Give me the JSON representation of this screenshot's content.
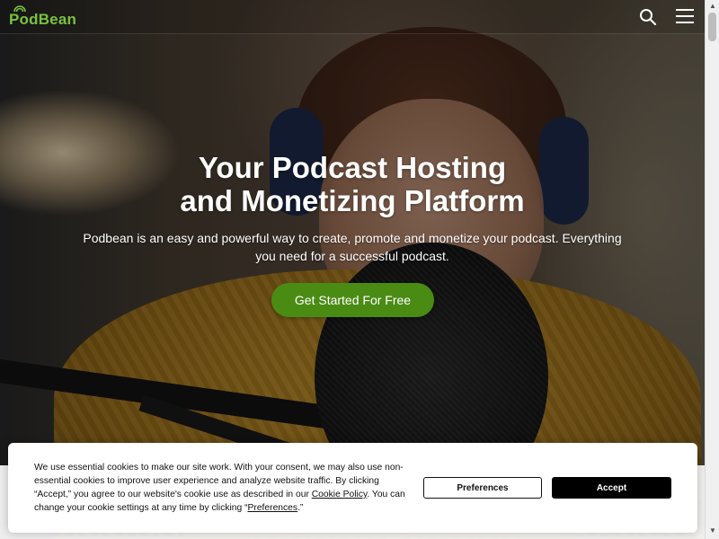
{
  "header": {
    "logo_text": "PodBean",
    "search_icon": "search-icon",
    "menu_icon": "hamburger-menu-icon"
  },
  "hero": {
    "title_line1": "Your Podcast Hosting",
    "title_line2": "and Monetizing Platform",
    "subtitle_line1": "Podbean is an easy and powerful way to create, promote and monetize your podcast. Everything",
    "subtitle_line2": "you need for a successful podcast.",
    "cta_label": "Get Started For Free"
  },
  "cookie_banner": {
    "text_part1": "We use essential cookies to make our site work. With your consent, we may also use non-essential cookies to improve user experience and analyze website traffic. By clicking “Accept,” you agree to our website's cookie use as described in our ",
    "cookie_policy_link": "Cookie Policy",
    "text_part2": ". You can change your cookie settings at any time by clicking “",
    "preferences_link": "Preferences",
    "text_part3": ".”",
    "preferences_button": "Preferences",
    "accept_button": "Accept"
  },
  "colors": {
    "brand_green": "#7ac142",
    "cta_green": "#4a8b14",
    "accept_black": "#000000"
  }
}
